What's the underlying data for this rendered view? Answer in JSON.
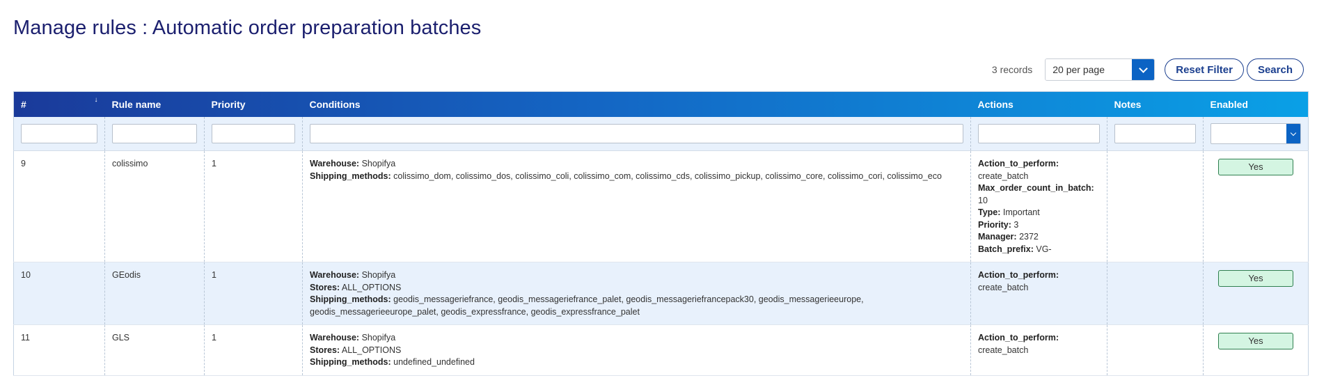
{
  "page": {
    "title": "Manage rules : Automatic order preparation batches"
  },
  "toolbar": {
    "records": "3 records",
    "per_page": "20 per page",
    "reset_label": "Reset Filter",
    "search_label": "Search"
  },
  "table": {
    "columns": [
      "#",
      "Rule name",
      "Priority",
      "Conditions",
      "Actions",
      "Notes",
      "Enabled"
    ],
    "rows": [
      {
        "id": "9",
        "name": "colissimo",
        "priority": "1",
        "conditions": [
          {
            "k": "Warehouse:",
            "v": "Shopifya"
          },
          {
            "k": "Shipping_methods:",
            "v": "colissimo_dom, colissimo_dos, colissimo_coli, colissimo_com, colissimo_cds, colissimo_pickup, colissimo_core, colissimo_cori, colissimo_eco"
          }
        ],
        "actions": [
          {
            "k": "Action_to_perform:",
            "v": "create_batch",
            "block": true
          },
          {
            "k": "Max_order_count_in_batch:",
            "v": "10"
          },
          {
            "k": "Type:",
            "v": "Important"
          },
          {
            "k": "Priority:",
            "v": "3"
          },
          {
            "k": "Manager:",
            "v": "2372"
          },
          {
            "k": "Batch_prefix:",
            "v": "VG-"
          }
        ],
        "notes": "",
        "enabled": "Yes"
      },
      {
        "id": "10",
        "name": "GEodis",
        "priority": "1",
        "conditions": [
          {
            "k": "Warehouse:",
            "v": "Shopifya"
          },
          {
            "k": "Stores:",
            "v": "ALL_OPTIONS"
          },
          {
            "k": "Shipping_methods:",
            "v": "geodis_messageriefrance, geodis_messageriefrance_palet, geodis_messageriefrancepack30, geodis_messagerieeurope,",
            "v2": "geodis_messagerieeurope_palet, geodis_expressfrance, geodis_expressfrance_palet"
          }
        ],
        "actions": [
          {
            "k": "Action_to_perform:",
            "v": "create_batch",
            "block": true
          }
        ],
        "notes": "",
        "enabled": "Yes"
      },
      {
        "id": "11",
        "name": "GLS",
        "priority": "1",
        "conditions": [
          {
            "k": "Warehouse:",
            "v": "Shopifya"
          },
          {
            "k": "Stores:",
            "v": "ALL_OPTIONS"
          },
          {
            "k": "Shipping_methods:",
            "v": "undefined_undefined"
          }
        ],
        "actions": [
          {
            "k": "Action_to_perform:",
            "v": "create_batch",
            "block": true
          }
        ],
        "notes": "",
        "enabled": "Yes"
      }
    ]
  },
  "icons": {
    "sort": "sort-arrow-icon",
    "dropdown": "chevron-down-icon"
  },
  "colors": {
    "title": "#1b1f6e",
    "header_start": "#1a3a9a",
    "header_end": "#0aa0e6",
    "row_alt": "#e8f1fc",
    "enabled_badge": "#d4f5e2",
    "accent": "#0b63c4"
  }
}
